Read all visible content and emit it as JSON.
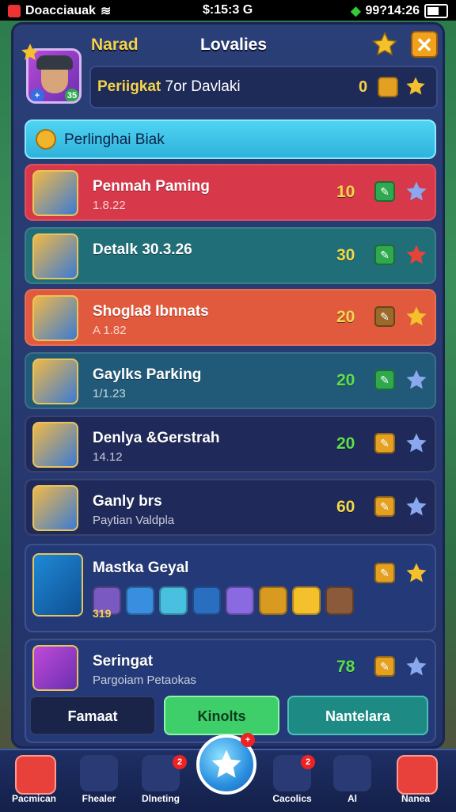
{
  "status_bar": {
    "app": "Doacciauak",
    "time": "$:15:3 G",
    "right": "99?14:26"
  },
  "header": {
    "left_title": "Narad",
    "center_title": "Lovalies"
  },
  "profile": {
    "badge_left": "+",
    "badge_right": "35",
    "info_label": "Periigkat",
    "info_value": "7or Davlaki",
    "info_number": "0"
  },
  "section": {
    "title": "Perlinghai Biak"
  },
  "rows": [
    {
      "name": "Penmah Paming",
      "sub": "1.8.22",
      "score": "10",
      "score_color": "#f2d94a",
      "bg": "#d8394a",
      "star_color": "#8aa8ee",
      "edit_color": "#2fa84f"
    },
    {
      "name": "Detalk 30.3.26",
      "sub": "",
      "score": "30",
      "score_color": "#f2d94a",
      "bg": "#1f6e78",
      "star_color": "#e5443b",
      "edit_color": "#2fa84f"
    },
    {
      "name": "Shogla8 Ibnnats",
      "sub": "A 1.82",
      "score": "20",
      "score_color": "#f2d94a",
      "bg": "#e25a3e",
      "star_color": "#f4c02c",
      "edit_color": "#9b6a2a"
    },
    {
      "name": "Gaylks Parking",
      "sub": "1/1.23",
      "score": "20",
      "score_color": "#5ce04a",
      "bg": "#215a78",
      "star_color": "#8aa8ee",
      "edit_color": "#2fa84f"
    },
    {
      "name": "Denlya &Gerstrah",
      "sub": "14.12",
      "score": "20",
      "score_color": "#5ce04a",
      "bg": "#1f2a5a",
      "star_color": "#8aa8ee",
      "edit_color": "#e4a021"
    },
    {
      "name": "Ganly brs",
      "sub": "Paytian Valdpla",
      "score": "60",
      "score_color": "#f2d94a",
      "bg": "#1f2a5a",
      "star_color": "#8aa8ee",
      "edit_color": "#e4a021"
    }
  ],
  "special_row": {
    "name": "Mastka Geyal",
    "gem_count": "319"
  },
  "last_row": {
    "name": "Seringat",
    "sub": "Pargoiam Petaokas",
    "score": "78"
  },
  "actions": {
    "left": "Famaat",
    "middle": "Kinolts",
    "right": "Nantelara"
  },
  "nav": {
    "items": [
      {
        "label": "Pacmican"
      },
      {
        "label": "Fhealer"
      },
      {
        "label": "Dlneting",
        "badge": "2"
      },
      {
        "label": "Cacolics",
        "badge": "2"
      },
      {
        "label": "Al"
      },
      {
        "label": "Nanea"
      }
    ],
    "center_badge": "+"
  }
}
